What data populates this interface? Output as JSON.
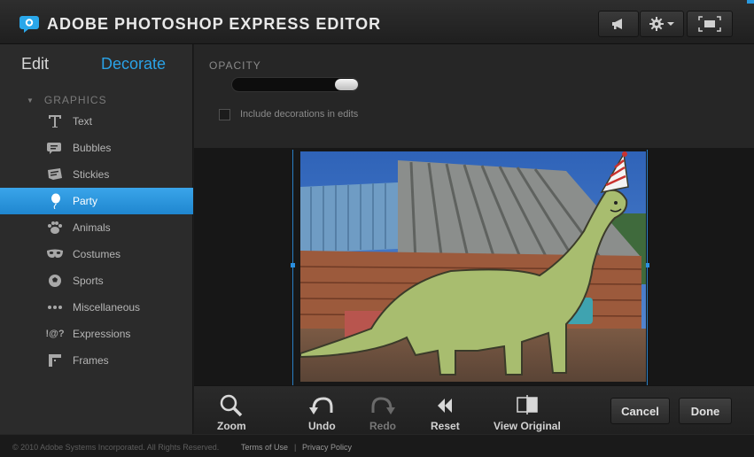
{
  "header": {
    "title": "ADOBE PHOTOSHOP EXPRESS EDITOR",
    "icons": [
      "megaphone-icon",
      "gear-icon",
      "fullscreen-icon"
    ]
  },
  "sidebar": {
    "tabs": {
      "edit": "Edit",
      "decorate": "Decorate"
    },
    "section": "GRAPHICS",
    "items": [
      {
        "label": "Text",
        "icon": "text-icon"
      },
      {
        "label": "Bubbles",
        "icon": "bubbles-icon"
      },
      {
        "label": "Stickies",
        "icon": "stickies-icon"
      },
      {
        "label": "Party",
        "icon": "party-icon",
        "selected": true
      },
      {
        "label": "Animals",
        "icon": "paw-icon"
      },
      {
        "label": "Costumes",
        "icon": "mask-icon"
      },
      {
        "label": "Sports",
        "icon": "sports-icon"
      },
      {
        "label": "Miscellaneous",
        "icon": "ellipsis-icon"
      },
      {
        "label": "Expressions",
        "icon": "expressions-icon",
        "icon_text": "!@?"
      },
      {
        "label": "Frames",
        "icon": "frames-icon"
      }
    ]
  },
  "options": {
    "opacity_label": "OPACITY",
    "opacity_value": 1.0,
    "include_label": "Include decorations in edits",
    "include_checked": false
  },
  "toolbar": {
    "zoom": "Zoom",
    "undo": "Undo",
    "redo": "Redo",
    "reset": "Reset",
    "view_original": "View Original",
    "cancel": "Cancel",
    "done": "Done"
  },
  "footer": {
    "copyright": "© 2010 Adobe Systems Incorporated. All Rights Reserved.",
    "terms": "Terms of Use",
    "separator": "|",
    "privacy": "Privacy Policy"
  },
  "colors": {
    "accent": "#2aa2e6",
    "selection": "#2a8fe0",
    "selected_item": "#2b93dc"
  }
}
